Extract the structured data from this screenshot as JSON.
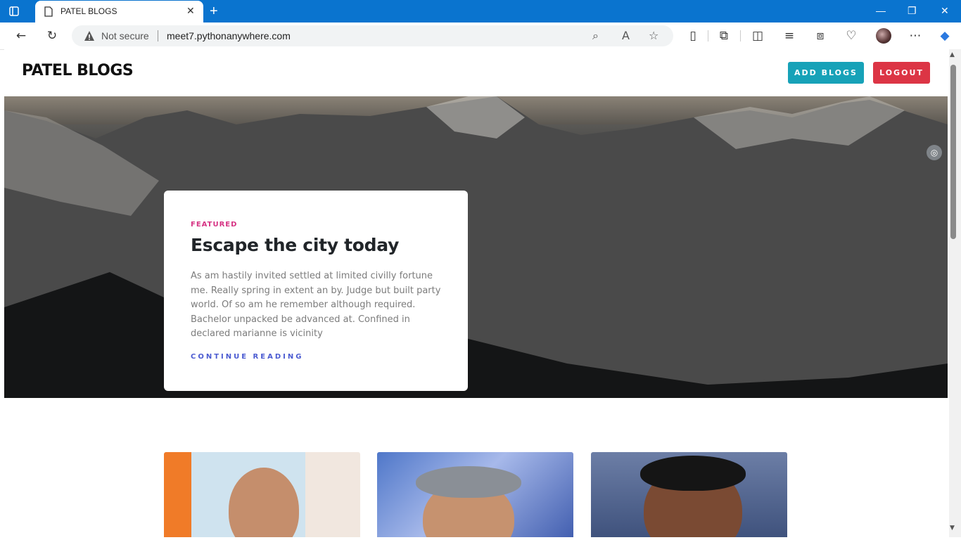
{
  "browser": {
    "tab_title": "PATEL BLOGS",
    "new_tab_symbol": "+",
    "security_label": "Not secure",
    "url": "meet7.pythonanywhere.com"
  },
  "site": {
    "brand": "PATEL BLOGS",
    "add_blogs_label": "ADD BLOGS",
    "logout_label": "LOGOUT"
  },
  "featured": {
    "tag": "FEATURED",
    "title": "Escape the city today",
    "excerpt": "As am hastily invited settled at limited civilly fortune me. Really spring in extent an by. Judge but built party world. Of so am he remember although required. Bachelor unpacked be advanced at. Confined in declared marianne is vicinity",
    "cta": "CONTINUE READING"
  },
  "colors": {
    "titlebar": "#0a74cf",
    "add_button": "#17a2b8",
    "logout_button": "#dc3545",
    "featured_tag": "#d63384",
    "cta_link": "#4b5bd1"
  },
  "posts": [
    {
      "image": "portrait-photo"
    },
    {
      "image": "portrait-photo"
    },
    {
      "image": "portrait-photo"
    }
  ]
}
